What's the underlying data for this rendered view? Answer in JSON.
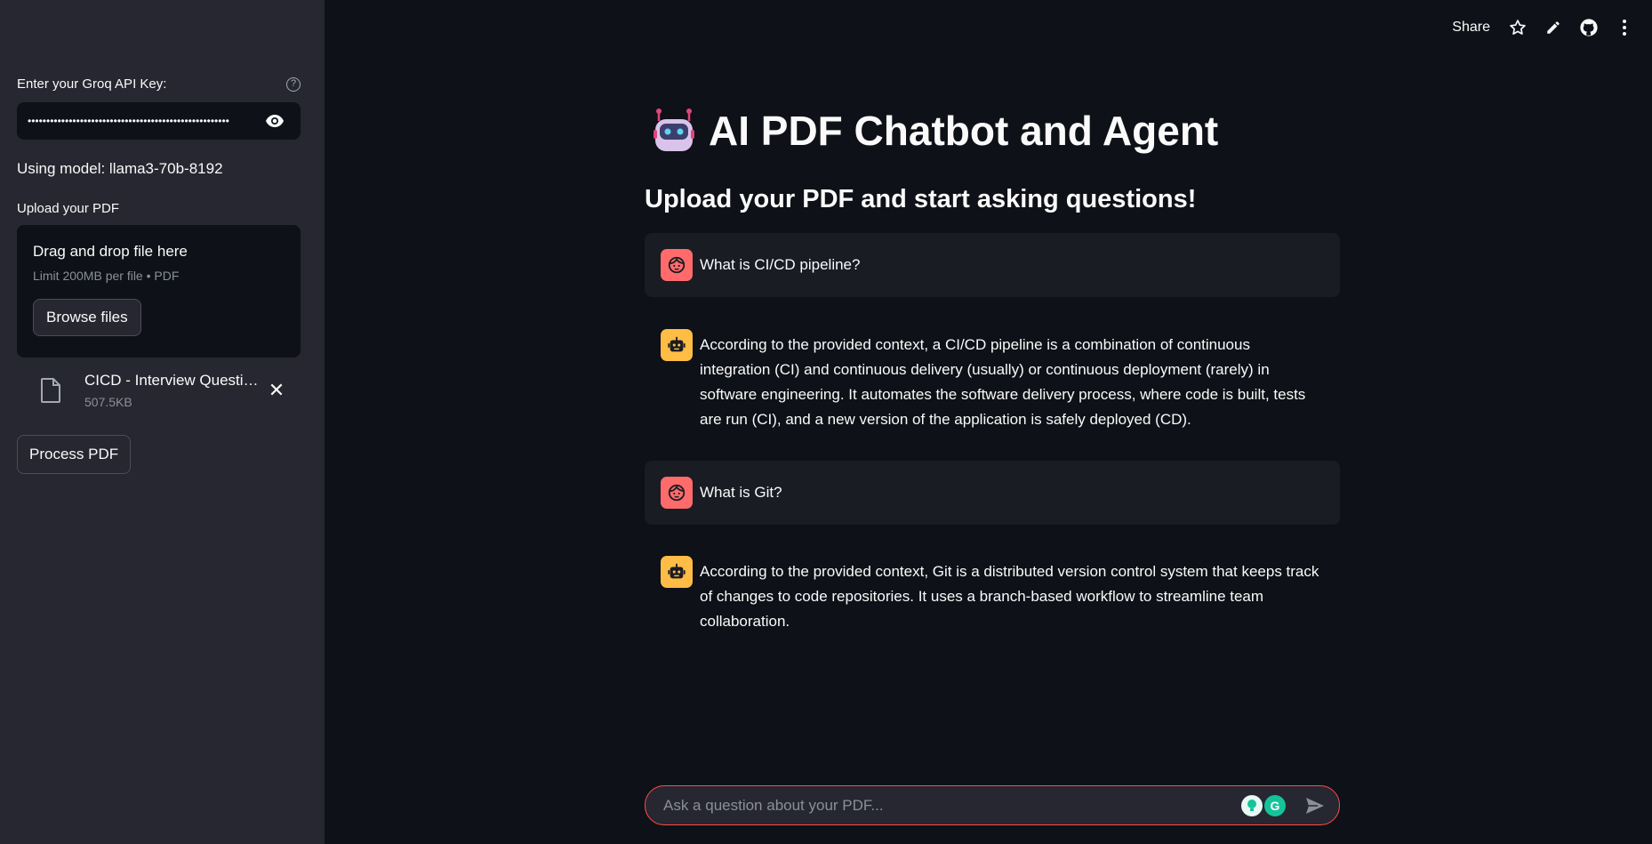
{
  "sidebar": {
    "api_key_label": "Enter your Groq API Key:",
    "api_key_value": "••••••••••••••••••••••••••••••••••••••••••••••••••••••",
    "model_text": "Using model: llama3-70b-8192",
    "upload_label": "Upload your PDF",
    "dropzone_title": "Drag and drop file here",
    "dropzone_sub": "Limit 200MB per file • PDF",
    "browse_label": "Browse files",
    "file_name": "CICD - Interview Questions.pdf",
    "file_size": "507.5KB",
    "process_label": "Process PDF"
  },
  "topbar": {
    "share_label": "Share"
  },
  "main": {
    "title": "AI PDF Chatbot and Agent",
    "subtitle": "Upload your PDF and start asking questions!",
    "messages": [
      {
        "role": "user",
        "text": "What is CI/CD pipeline?"
      },
      {
        "role": "assistant",
        "text": "According to the provided context, a CI/CD pipeline is a combination of continuous integration (CI) and continuous delivery (usually) or continuous deployment (rarely) in software engineering. It automates the software delivery process, where code is built, tests are run (CI), and a new version of the application is safely deployed (CD)."
      },
      {
        "role": "user",
        "text": "What is Git?"
      },
      {
        "role": "assistant",
        "text": "According to the provided context, Git is a distributed version control system that keeps track of changes to code repositories. It uses a branch-based workflow to streamline team collaboration."
      }
    ]
  },
  "chat_input": {
    "placeholder": "Ask a question about your PDF..."
  },
  "colors": {
    "accent": "#ff4b4b",
    "user_avatar": "#ff6b6b",
    "bot_avatar": "#ffbd45"
  }
}
